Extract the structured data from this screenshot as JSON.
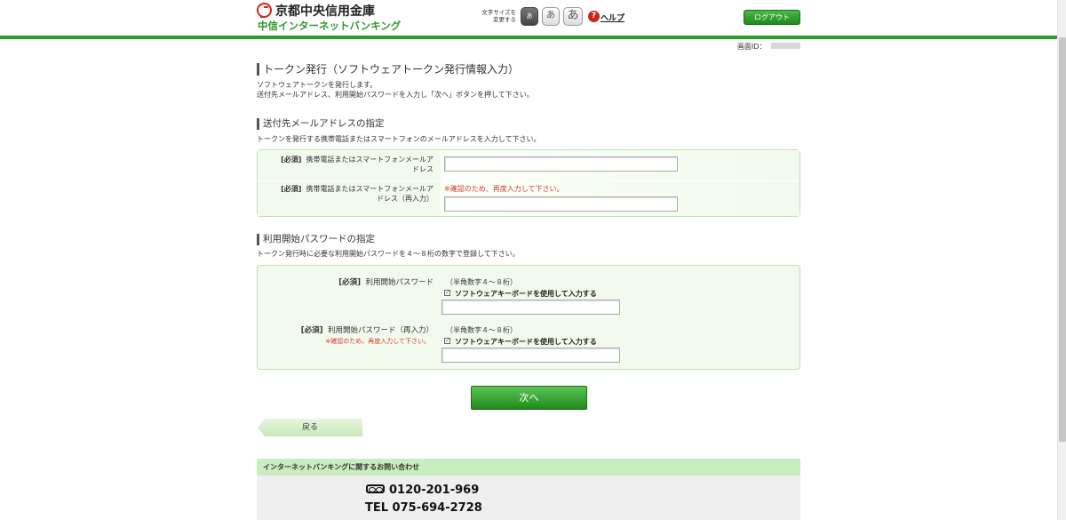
{
  "header": {
    "bank_name": "京都中央信用金庫",
    "service_name": "中信インターネットバンキング",
    "font_size_label": [
      "文字サイズを",
      "変更する"
    ],
    "font_buttons": [
      "あ",
      "あ",
      "あ"
    ],
    "help_label": "ヘルプ",
    "logout_label": "ログアウト"
  },
  "screen_id_label": "画面ID：",
  "page": {
    "title": "トークン発行（ソフトウェアトークン発行情報入力）",
    "intro_1": "ソフトウェアトークンを発行します。",
    "intro_2": "送付先メールアドレス、利用開始パスワードを入力し「次へ」ボタンを押して下さい。"
  },
  "email_section": {
    "title": "送付先メールアドレスの指定",
    "description": "トークンを発行する携帯電話またはスマートフォンのメールアドレスを入力して下さい。",
    "required_tag": "[必須]",
    "field1_label": [
      "携帯電話またはスマートフォンメールア",
      "ドレス"
    ],
    "field2_label": [
      "携帯電話またはスマートフォンメールア",
      "ドレス（再入力）"
    ],
    "confirm_note": "※確認のため、再度入力して下さい。",
    "field1_value": "",
    "field2_value": ""
  },
  "password_section": {
    "title": "利用開始パスワードの指定",
    "description": "トークン発行時に必要な利用開始パスワードを４～８桁の数字で登録して下さい。",
    "required_tag": "[必須]",
    "field1_label": "利用開始パスワード",
    "field2_label": "利用開始パスワード（再入力）",
    "field2_note": "※確認のため、再度入力して下さい。",
    "hint": "（半角数字４～８桁）",
    "checkbox_label": "ソフトウェアキーボードを使用して入力する",
    "checkbox_checked": true,
    "field1_value": "",
    "field2_value": ""
  },
  "buttons": {
    "next": "次へ",
    "back": "戻る"
  },
  "contact": {
    "heading": "インターネットバンキングに関するお問い合わせ",
    "freedial": "0120-201-969",
    "tel": "TEL 075-694-2728"
  },
  "colors": {
    "brand_green": "#2f9a2c",
    "panel_bg": "#f2faed",
    "warning_red": "#d63a2a"
  }
}
